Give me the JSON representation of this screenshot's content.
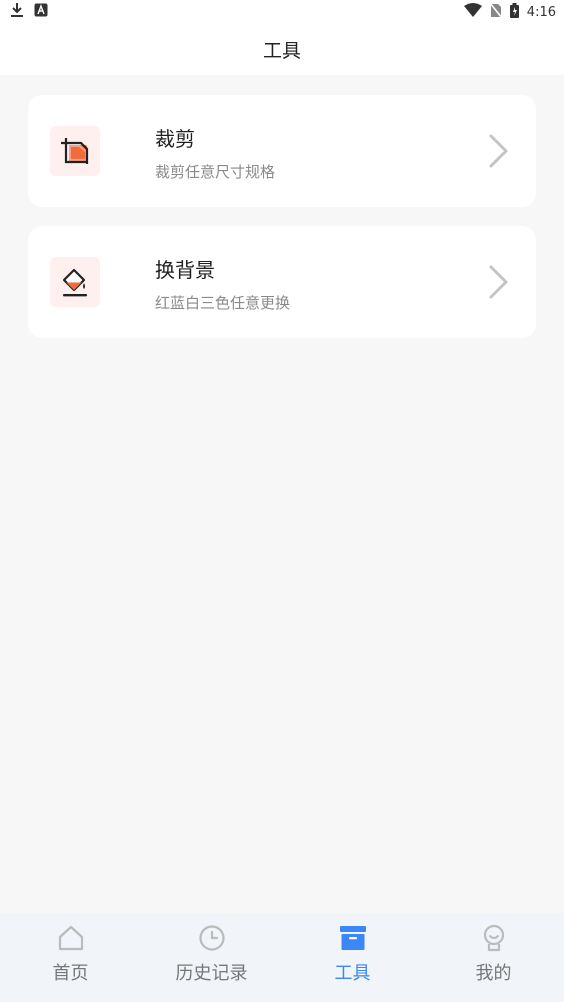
{
  "status_bar": {
    "time": "4:16",
    "left_icons": [
      "download-icon",
      "a-badge-icon"
    ],
    "right_icons": [
      "wifi-icon",
      "no-sim-icon",
      "battery-icon"
    ]
  },
  "app_bar": {
    "title": "工具"
  },
  "tools": [
    {
      "title": "裁剪",
      "subtitle": "裁剪任意尺寸规格",
      "icon": "crop-icon"
    },
    {
      "title": "换背景",
      "subtitle": "红蓝白三色任意更换",
      "icon": "paint-bucket-icon"
    }
  ],
  "tab_bar": {
    "tabs": [
      {
        "label": "首页",
        "icon": "home-icon",
        "active": false
      },
      {
        "label": "历史记录",
        "icon": "clock-icon",
        "active": false
      },
      {
        "label": "工具",
        "icon": "toolbox-icon",
        "active": true
      },
      {
        "label": "我的",
        "icon": "profile-icon",
        "active": false
      }
    ]
  },
  "colors": {
    "accent": "#3d86f7",
    "icon_bg": "#fdf0ef",
    "icon_orange": "#f26b3a",
    "background": "#f7f7f7"
  }
}
